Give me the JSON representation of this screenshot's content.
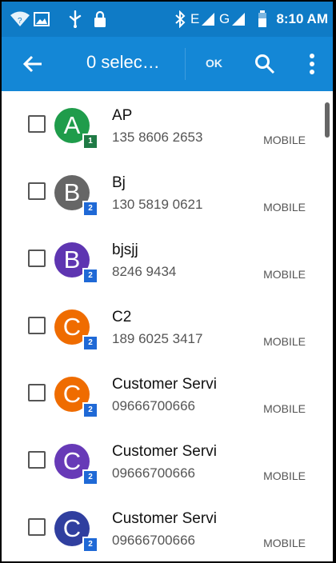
{
  "status_bar": {
    "time": "8:10 AM",
    "network_e": "E",
    "network_g": "G",
    "icons": [
      "wifi-icon",
      "image-icon",
      "usb-icon",
      "lock-icon",
      "bluetooth-icon",
      "signal-icon",
      "battery-icon"
    ]
  },
  "app_bar": {
    "title": "0 selec…",
    "ok_label": "OK",
    "icons": [
      "back-arrow-icon",
      "search-icon",
      "more-vert-icon"
    ]
  },
  "contacts": [
    {
      "name": "AP",
      "number": "135 8606 2653",
      "type": "MOBILE",
      "avatar_letter": "A",
      "avatar_color": "#1f9c4b",
      "badge": "1"
    },
    {
      "name": "Bj",
      "number": "130 5819 0621",
      "type": "MOBILE",
      "avatar_letter": "B",
      "avatar_color": "#666666",
      "badge": "2"
    },
    {
      "name": "bjsjj",
      "number": "8246 9434",
      "type": "MOBILE",
      "avatar_letter": "B",
      "avatar_color": "#5e35b1",
      "badge": "2"
    },
    {
      "name": "C2",
      "number": "189 6025 3417",
      "type": "MOBILE",
      "avatar_letter": "C",
      "avatar_color": "#ef6c00",
      "badge": "2"
    },
    {
      "name": "Customer Servi",
      "number": "09666700666",
      "type": "MOBILE",
      "avatar_letter": "C",
      "avatar_color": "#ef6c00",
      "badge": "2"
    },
    {
      "name": "Customer Servi",
      "number": "09666700666",
      "type": "MOBILE",
      "avatar_letter": "C",
      "avatar_color": "#673ab7",
      "badge": "2"
    },
    {
      "name": "Customer Servi",
      "number": "09666700666",
      "type": "MOBILE",
      "avatar_letter": "C",
      "avatar_color": "#303f9f",
      "badge": "2"
    }
  ]
}
